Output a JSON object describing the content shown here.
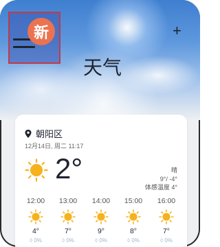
{
  "header": {
    "badge": "新",
    "title": "天气",
    "add": "+"
  },
  "location": {
    "name": "朝阳区",
    "date": "12月14日, 周二 11:17"
  },
  "current": {
    "temp": "2°",
    "condition": "晴",
    "range": "9°/ -4°",
    "feels": "体感温度 4°"
  },
  "hourly": [
    {
      "time": "12:00",
      "temp": "4°",
      "precip": "0%"
    },
    {
      "time": "13:00",
      "temp": "7°",
      "precip": "0%"
    },
    {
      "time": "14:00",
      "temp": "9°",
      "precip": "0%"
    },
    {
      "time": "15:00",
      "temp": "8°",
      "precip": "0%"
    },
    {
      "time": "16:00",
      "temp": "7°",
      "precip": "0%"
    }
  ],
  "colors": {
    "sun": "#f5b21c",
    "badge": "#ec7350",
    "highlight": "#c23a46"
  }
}
